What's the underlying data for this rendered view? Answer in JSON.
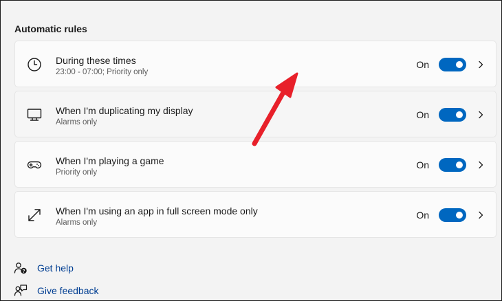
{
  "section": {
    "title": "Automatic rules"
  },
  "rules": [
    {
      "title": "During these times",
      "subtitle": "23:00 - 07:00; Priority only",
      "state": "On",
      "icon": "clock-icon"
    },
    {
      "title": "When I'm duplicating my display",
      "subtitle": "Alarms only",
      "state": "On",
      "icon": "monitor-icon"
    },
    {
      "title": "When I'm playing a game",
      "subtitle": "Priority only",
      "state": "On",
      "icon": "gamepad-icon"
    },
    {
      "title": "When I'm using an app in full screen mode only",
      "subtitle": "Alarms only",
      "state": "On",
      "icon": "fullscreen-icon"
    }
  ],
  "links": {
    "help": "Get help",
    "feedback": "Give feedback"
  },
  "colors": {
    "accent": "#0067c0",
    "link": "#003e92",
    "annotation_arrow": "#e8202a"
  }
}
